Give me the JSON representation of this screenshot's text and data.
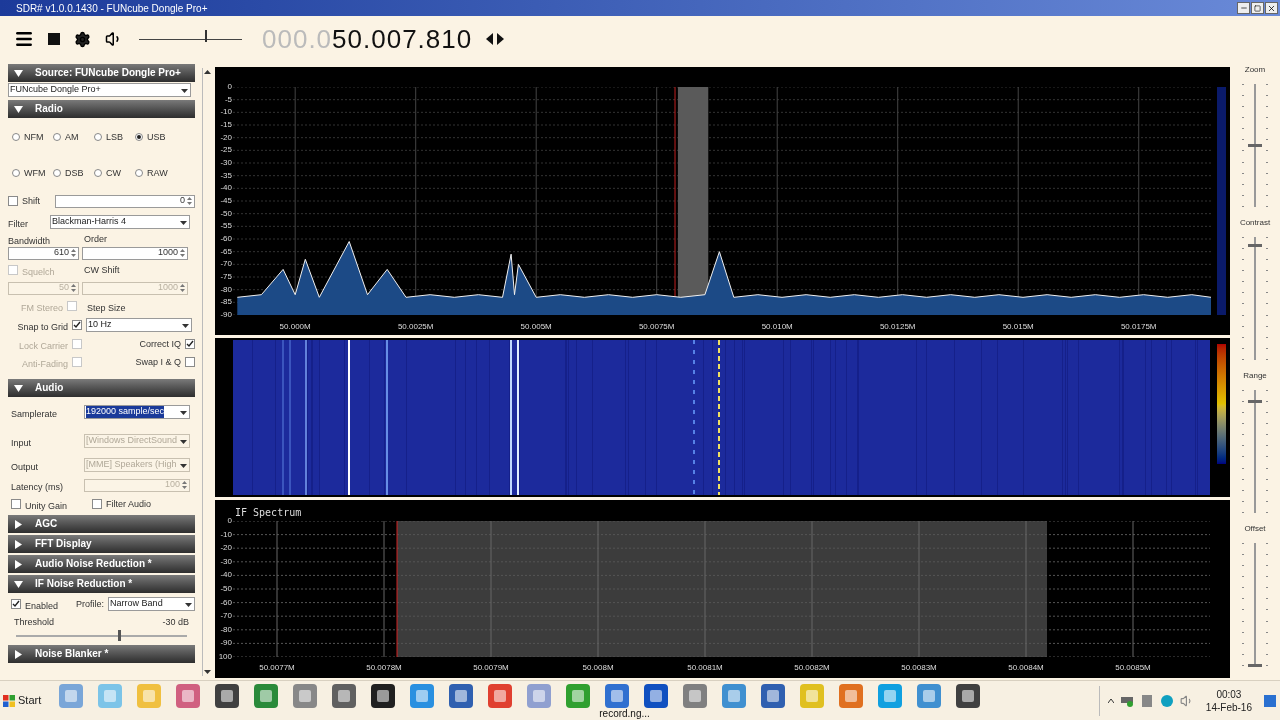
{
  "window": {
    "title": "SDR# v1.0.0.1430 - FUNcube Dongle Pro+"
  },
  "toolbar": {
    "volume": {
      "level": 0.64
    },
    "frequency_dim": "000.0",
    "frequency": "50.007.810"
  },
  "source": {
    "header": "Source: FUNcube Dongle Pro+",
    "expanded": true,
    "device": "FUNcube Dongle Pro+"
  },
  "radio": {
    "header": "Radio",
    "expanded": true,
    "modes": [
      {
        "label": "NFM",
        "selected": false
      },
      {
        "label": "AM",
        "selected": false
      },
      {
        "label": "LSB",
        "selected": false
      },
      {
        "label": "USB",
        "selected": true
      },
      {
        "label": "WFM",
        "selected": false
      },
      {
        "label": "DSB",
        "selected": false
      },
      {
        "label": "CW",
        "selected": false
      },
      {
        "label": "RAW",
        "selected": false
      }
    ],
    "shift": {
      "label": "Shift",
      "checked": false,
      "disabled": false,
      "value": "0"
    },
    "filter": {
      "label": "Filter",
      "value": "Blackman-Harris 4"
    },
    "bandwidth": {
      "label": "Bandwidth",
      "value": "610",
      "disabled": false
    },
    "order": {
      "label": "Order",
      "value": "1000",
      "disabled": false
    },
    "squelch": {
      "label": "Squelch",
      "checked": false,
      "disabled": true,
      "value": "50"
    },
    "cw_shift": {
      "label": "CW Shift",
      "value": "1000",
      "disabled": true
    },
    "fm_stereo": {
      "label": "FM Stereo",
      "checked": false,
      "disabled": true
    },
    "step_size": {
      "label": "Step Size",
      "value": "10 Hz"
    },
    "snap_to_grid": {
      "label": "Snap to Grid",
      "checked": true,
      "disabled": false
    },
    "lock_carrier": {
      "label": "Lock Carrier",
      "checked": false,
      "disabled": true
    },
    "correct_iq": {
      "label": "Correct IQ",
      "checked": true,
      "disabled": false
    },
    "anti_fading": {
      "label": "Anti-Fading",
      "checked": false,
      "disabled": true
    },
    "swap_iq": {
      "label": "Swap I & Q",
      "checked": false,
      "disabled": false
    }
  },
  "audio": {
    "header": "Audio",
    "expanded": true,
    "samplerate": {
      "label": "Samplerate",
      "value": "192000 sample/sec",
      "selected": true,
      "disabled": false
    },
    "input": {
      "label": "Input",
      "value": "[Windows DirectSound",
      "selected": false,
      "disabled": true
    },
    "output": {
      "label": "Output",
      "value": "[MME] Speakers (High",
      "selected": false,
      "disabled": true
    },
    "latency": {
      "label": "Latency (ms)",
      "value": "100",
      "disabled": true
    },
    "unity_gain": {
      "label": "Unity Gain",
      "checked": false,
      "disabled": false
    },
    "filter_audio": {
      "label": "Filter Audio",
      "checked": false,
      "disabled": false
    }
  },
  "collapsed_sections": [
    {
      "header": "AGC",
      "expanded": false
    },
    {
      "header": "FFT Display",
      "expanded": false
    },
    {
      "header": "Audio Noise Reduction *",
      "expanded": false
    }
  ],
  "if_noise_reduction": {
    "header": "IF Noise Reduction *",
    "expanded": true,
    "enabled": {
      "label": "Enabled",
      "checked": true,
      "disabled": false
    },
    "profile": {
      "label": "Profile:",
      "value": "Narrow Band"
    },
    "threshold": {
      "label": "Threshold",
      "reading": "-30 dB",
      "level": 0.6
    }
  },
  "noise_blanker": {
    "header": "Noise Blanker *",
    "expanded": false
  },
  "spectrum": {
    "chart_data": {
      "type": "line",
      "grid": true,
      "xlim": [
        49.99871,
        50.01902
      ],
      "ylim": [
        -90,
        0
      ],
      "bands": [
        {
          "axis": "x",
          "from": 50.00794,
          "to": 50.00857,
          "color": "#5a5a5a"
        }
      ],
      "ref_lines": [
        {
          "axis": "x",
          "value": 50.00788,
          "color": "#c02020"
        }
      ],
      "xticks": [
        {
          "value": 50.0,
          "label": "50.000M"
        },
        {
          "value": 50.0025,
          "label": "50.0025M"
        },
        {
          "value": 50.005,
          "label": "50.005M"
        },
        {
          "value": 50.0075,
          "label": "50.0075M"
        },
        {
          "value": 50.01,
          "label": "50.010M"
        },
        {
          "value": 50.0125,
          "label": "50.0125M"
        },
        {
          "value": 50.015,
          "label": "50.015M"
        },
        {
          "value": 50.0175,
          "label": "50.0175M"
        }
      ],
      "yticks": [
        0,
        -5,
        -10,
        -15,
        -20,
        -25,
        -30,
        -35,
        -40,
        -45,
        -50,
        -55,
        -60,
        -65,
        -70,
        -75,
        -80,
        -85,
        -90
      ],
      "x": [
        49.9988,
        49.9993,
        49.99975,
        50.0,
        50.00021,
        50.0005,
        50.00112,
        50.0015,
        50.00191,
        50.0023,
        50.0028,
        50.0033,
        50.0038,
        50.0043,
        50.00448,
        50.00455,
        50.00463,
        50.005,
        50.0055,
        50.006,
        50.0065,
        50.007,
        50.0075,
        50.008,
        50.0085,
        50.0088,
        50.0091,
        50.0096,
        50.0101,
        50.0106,
        50.0111,
        50.0116,
        50.0121,
        50.0126,
        50.0131,
        50.0136,
        50.0141,
        50.0146,
        50.0151,
        50.0156,
        50.0161,
        50.0166,
        50.0171,
        50.0176,
        50.0181,
        50.0186,
        50.019
      ],
      "series": [
        {
          "color": "#f0f0f0",
          "values": [
            -83,
            -82,
            -72,
            -82,
            -68,
            -83,
            -61,
            -82,
            -72,
            -83,
            -82,
            -83,
            -82,
            -83,
            -66,
            -82,
            -70,
            -83,
            -82,
            -83,
            -82,
            -83,
            -82,
            -83,
            -82,
            -65,
            -83,
            -82,
            -83,
            -82,
            -83,
            -82,
            -83,
            -82,
            -83,
            -82,
            -83,
            -82,
            -83,
            -82,
            -83,
            -82,
            -83,
            -82,
            -83,
            -82,
            -83
          ]
        }
      ]
    }
  },
  "if_spectrum": {
    "title": "IF Spectrum",
    "y_labels": [
      "0",
      "-10",
      "-20",
      "-30",
      "-40",
      "-50",
      "-60",
      "-70",
      "-80",
      "-90",
      "100"
    ],
    "x_labels": [
      "50.0077M",
      "50.0078M",
      "50.0079M",
      "50.008M",
      "50.0081M",
      "50.0082M",
      "50.0083M",
      "50.0084M",
      "50.0085M"
    ]
  },
  "side_controls": [
    {
      "label": "Zoom",
      "level": 0.5
    },
    {
      "label": "Contrast",
      "level": 0.93
    },
    {
      "label": "Range",
      "level": 0.9
    },
    {
      "label": "Offset",
      "level": 0
    }
  ],
  "taskbar": {
    "start": "Start",
    "task_label": "record.ng...",
    "time": "00:03",
    "date": "14-Feb-16"
  }
}
